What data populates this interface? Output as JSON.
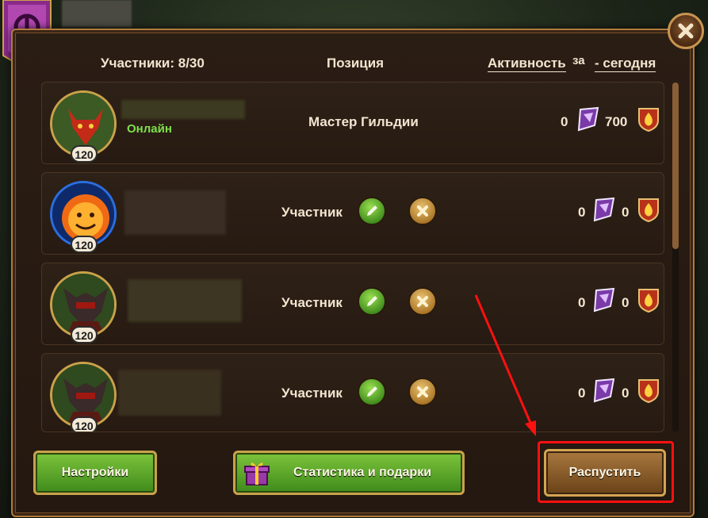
{
  "header": {
    "members_label": "Участники: 8/30",
    "position_label": "Позиция",
    "activity_label": "Активность",
    "activity_for": "за",
    "period_label": "- сегодня"
  },
  "members": [
    {
      "level": "120",
      "status": "Онлайн",
      "role": "Мастер Гильдии",
      "gems": "0",
      "points": "700",
      "avatar": "red-demon",
      "frame": "gold",
      "can_manage": false
    },
    {
      "level": "120",
      "status": "",
      "role": "Участник",
      "gems": "0",
      "points": "0",
      "avatar": "fire-spirit",
      "frame": "blue",
      "can_manage": true
    },
    {
      "level": "120",
      "status": "",
      "role": "Участник",
      "gems": "0",
      "points": "0",
      "avatar": "dark-knight",
      "frame": "gold",
      "can_manage": true
    },
    {
      "level": "120",
      "status": "",
      "role": "Участник",
      "gems": "0",
      "points": "0",
      "avatar": "dark-knight",
      "frame": "gold",
      "can_manage": true
    }
  ],
  "buttons": {
    "settings": "Настройки",
    "stats_gifts": "Статистика и подарки",
    "disband": "Распустить"
  },
  "colors": {
    "accent_gold": "#c9a24a",
    "online_green": "#7ee04a",
    "highlight_red": "#ff1010"
  }
}
